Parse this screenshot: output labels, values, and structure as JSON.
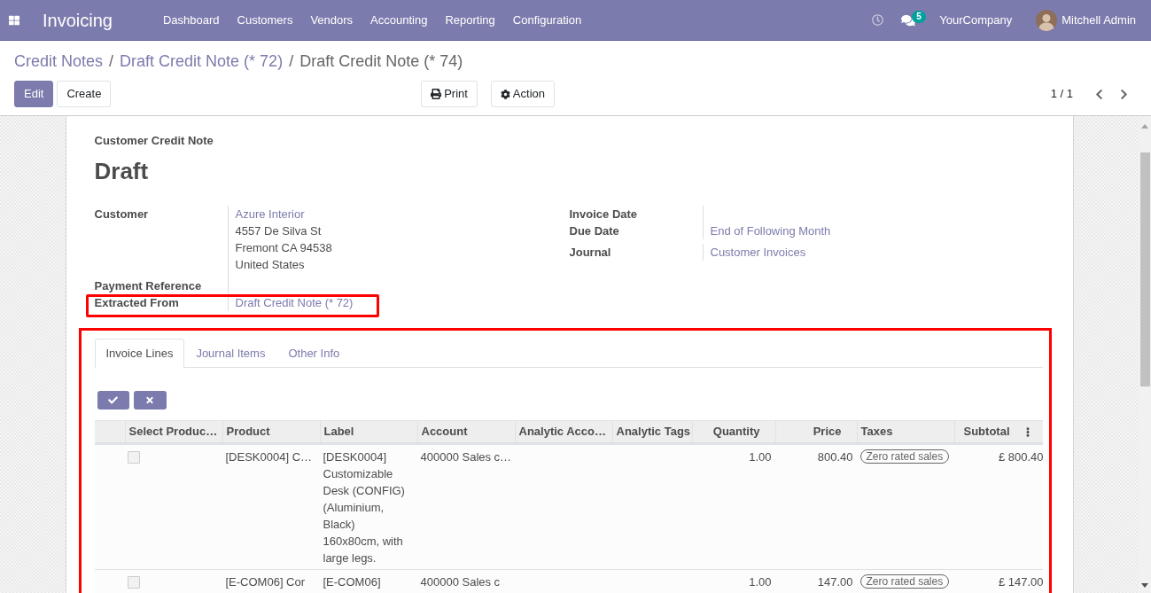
{
  "navbar": {
    "app_title": "Invoicing",
    "menu": [
      "Dashboard",
      "Customers",
      "Vendors",
      "Accounting",
      "Reporting",
      "Configuration"
    ],
    "message_count": "5",
    "company": "YourCompany",
    "user": "Mitchell Admin"
  },
  "breadcrumbs": {
    "items": [
      {
        "label": "Credit Notes",
        "current": false
      },
      {
        "label": "Draft Credit Note (* 72)",
        "current": false
      },
      {
        "label": "Draft Credit Note (* 74)",
        "current": true
      }
    ],
    "separators": [
      "/",
      "/"
    ]
  },
  "control_panel": {
    "buttons": [
      {
        "label": "Edit",
        "kind": "primary"
      },
      {
        "label": "Create",
        "kind": "secondary"
      }
    ],
    "actions": [
      {
        "label": "Print",
        "kind": "print"
      },
      {
        "label": "Action",
        "kind": "settings"
      }
    ],
    "pager": "1 / 1"
  },
  "form": {
    "document_type": "Customer Credit Note",
    "status": "Draft",
    "left_fields": [
      {
        "label": "Customer",
        "link": "Azure Interior",
        "lines": [
          "4557 De Silva St",
          "Fremont CA 94538",
          "United States"
        ],
        "highlighted": false
      },
      {
        "label": "Payment Reference",
        "highlighted": false
      },
      {
        "label": "Extracted From",
        "link": "Draft Credit Note (* 72)",
        "highlighted": true
      }
    ],
    "right_fields": [
      {
        "label": "Invoice Date"
      },
      {
        "label": "Due Date",
        "link": "End of Following Month"
      },
      {
        "label": "Journal",
        "link": "Customer Invoices"
      }
    ]
  },
  "notebook": {
    "highlighted": true,
    "tabs": [
      {
        "label": "Invoice Lines",
        "selected": true
      },
      {
        "label": "Journal Items",
        "selected": false
      },
      {
        "label": "Other Info",
        "selected": false
      }
    ],
    "table": {
      "columns": [
        {
          "label": "Select Produc…",
          "kind": "text"
        },
        {
          "label": "Product",
          "kind": "text"
        },
        {
          "label": "Label",
          "kind": "text"
        },
        {
          "label": "Account",
          "kind": "text"
        },
        {
          "label": "Analytic Acco…",
          "kind": "text"
        },
        {
          "label": "Analytic Tags",
          "kind": "text"
        },
        {
          "label": "Quantity",
          "kind": "number"
        },
        {
          "label": "Price",
          "kind": "number"
        },
        {
          "label": "Taxes",
          "kind": "text"
        },
        {
          "label": "Subtotal",
          "kind": "number"
        }
      ],
      "rows": [
        {
          "checked": false,
          "product": "[DESK0004] C…",
          "label": "[DESK0004] Customizable Desk (CONFIG) (Aluminium, Black) 160x80cm, with large legs.",
          "account": "400000 Sales c…",
          "quantity": "1.00",
          "price": "800.40",
          "taxes": [
            "Zero rated sales"
          ],
          "subtotal": "£ 800.40"
        },
        {
          "checked": false,
          "product": "[E-COM06] Cor",
          "label": "[E-COM06]",
          "account": "400000 Sales c",
          "quantity": "1.00",
          "price": "147.00",
          "taxes": [
            "Zero rated sales"
          ],
          "subtotal": "£ 147.00"
        }
      ]
    }
  }
}
